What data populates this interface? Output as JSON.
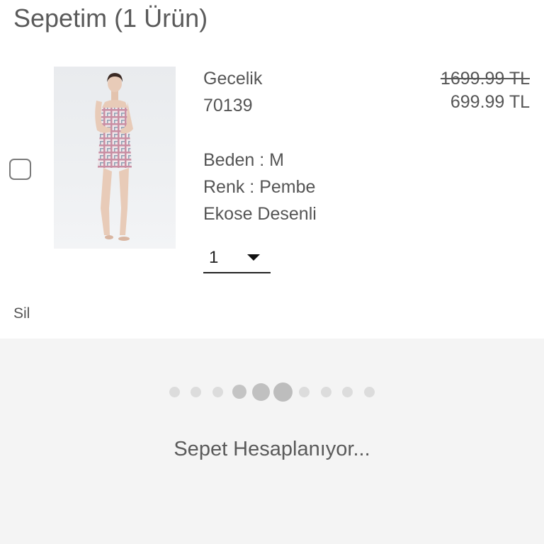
{
  "header": {
    "title": "Sepetim (1 Ürün)"
  },
  "cart_item": {
    "name": "Gecelik",
    "code": "70139",
    "size": "Beden : M",
    "color": "Renk : Pembe",
    "pattern": "Ekose Desenli",
    "price_old": "1699.99 TL",
    "price_new": "699.99 TL",
    "quantity": "1",
    "image_icon": "product-photo",
    "remove_label": "Sil"
  },
  "loading": {
    "text": "Sepet Hesaplanıyor...",
    "dot_count": 10,
    "colors": {
      "dot_light": "#dcdcdc",
      "dot_dark": "#bdbdbd",
      "panel_bg": "#f4f4f4"
    }
  }
}
